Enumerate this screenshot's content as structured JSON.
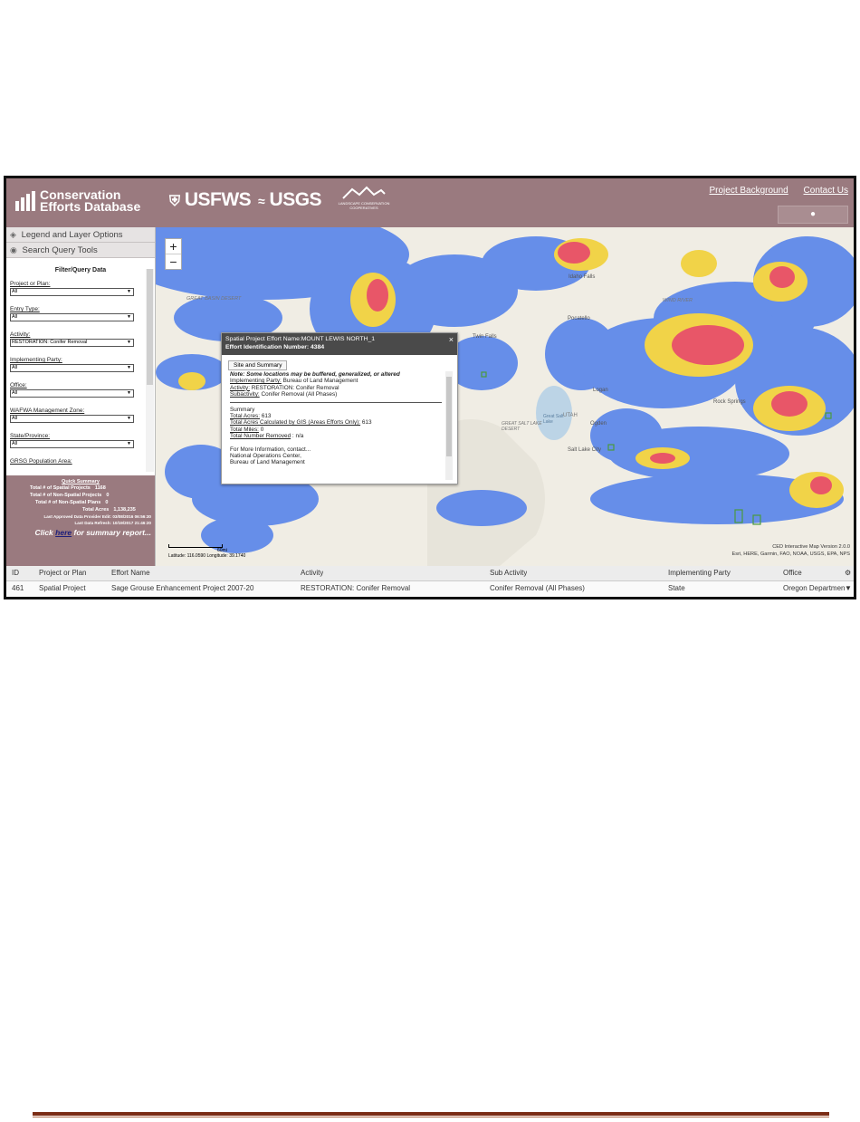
{
  "header": {
    "logo_line1": "Conservation",
    "logo_line2": "Efforts Database",
    "agency1": "USFWS",
    "agency2": "USGS",
    "lcc_text": "LANDSCAPE CONSERVATION COOPERATIVES",
    "links": [
      "Project Background",
      "Contact Us"
    ]
  },
  "sidebar": {
    "accordion": [
      {
        "label": "Legend and Layer Options"
      },
      {
        "label": "Search Query Tools"
      }
    ],
    "filter_title": "Filter/Query Data",
    "fields": [
      {
        "label": "Project or Plan:",
        "value": "All"
      },
      {
        "label": "Entry Type:",
        "value": "All"
      },
      {
        "label": "Activity:",
        "value": "RESTORATION: Conifer Removal"
      },
      {
        "label": "Implementing Party:",
        "value": "All"
      },
      {
        "label": "Office:",
        "value": "All"
      },
      {
        "label": "WAFWA Management Zone:",
        "value": "All"
      },
      {
        "label": "State/Province:",
        "value": "All"
      },
      {
        "label": "GRSG Population Area:",
        "value": ""
      }
    ],
    "summary": {
      "title": "Quick Summary",
      "rows": [
        {
          "label": "Total # of Spatial Projects",
          "value": "1168"
        },
        {
          "label": "Total # of Non-Spatial Projects",
          "value": "0"
        },
        {
          "label": "Total # of Non-Spatial Plans",
          "value": "0"
        },
        {
          "label": "Total Acres",
          "value": "1,138,235"
        }
      ],
      "approved": "Last Approved Data Provider Edit: 03/08/2016 06:56:30",
      "refresh": "Last Data Refresh: 10/19/2017 21:46:20",
      "click_pre": "Click",
      "click_link": "here",
      "click_post": "for summary report..."
    }
  },
  "map": {
    "zoom_in": "+",
    "zoom_out": "−",
    "labels": [
      {
        "text": "Twin Falls"
      },
      {
        "text": "Logan"
      },
      {
        "text": "GREAT SALT LAKE DESERT"
      },
      {
        "text": "Great Salt Lake"
      },
      {
        "text": "UTAH"
      },
      {
        "text": "Ogden"
      },
      {
        "text": "Salt Lake City"
      },
      {
        "text": "Rock Springs"
      },
      {
        "text": "Pocatello"
      },
      {
        "text": "Idaho Falls"
      },
      {
        "text": "GREAT BASIN DESERT"
      },
      {
        "text": "WIND RIVER"
      }
    ],
    "popup": {
      "title": "Spatial Project Effort Name:MOUNT LEWIS NORTH_1",
      "subtitle": "Effort Identification Number: 4384",
      "tab": "Site and Summary",
      "note": "Note: Some locations may be buffered, generalized, or altered",
      "implementing_label": "Implementing Party:",
      "implementing_value": "Bureau of Land Management",
      "activity_label": "Activity:",
      "activity_value": "RESTORATION: Conifer Removal",
      "subactivity_label": "Subactivity:",
      "subactivity_value": "Conifer Removal (All Phases)",
      "summary_head": "Summary",
      "acres_label": "Total Acres:",
      "acres_value": "613",
      "gis_label": "Total Acres Calculated by GIS (Areas Efforts Only):",
      "gis_value": "613",
      "miles_label": "Total Miles:",
      "miles_value": "0",
      "removed_label": "Total Number Removed",
      "removed_value": ": n/a",
      "contact1": "For More Information, contact...",
      "contact2": "National Operations Center,",
      "contact3": "Bureau of Land Management",
      "close": "×"
    },
    "scale_text": "60mi",
    "coords": "Latitude: 116.0590  Longitude: 39.1740",
    "version": "CED Interactive Map Version 2.0.0",
    "attribution": "Esri, HERE, Garmin, FAO, NOAA, USGS, EPA, NPS"
  },
  "table": {
    "headers": [
      "ID",
      "Project or Plan",
      "Effort Name",
      "Activity",
      "Sub Activity",
      "Implementing Party",
      "Office"
    ],
    "rows": [
      [
        "461",
        "Spatial Project",
        "Sage Grouse Enhancement Project 2007-20",
        "RESTORATION: Conifer Removal",
        "Conifer Removal (All Phases)",
        "State",
        "Oregon Department"
      ]
    ]
  },
  "colors": {
    "header_bg": "#9a7a7f",
    "heat_blue": "#4f7de8",
    "heat_yellow": "#f2d34a",
    "heat_red": "#e8556a",
    "rule": "#7b2c14"
  }
}
